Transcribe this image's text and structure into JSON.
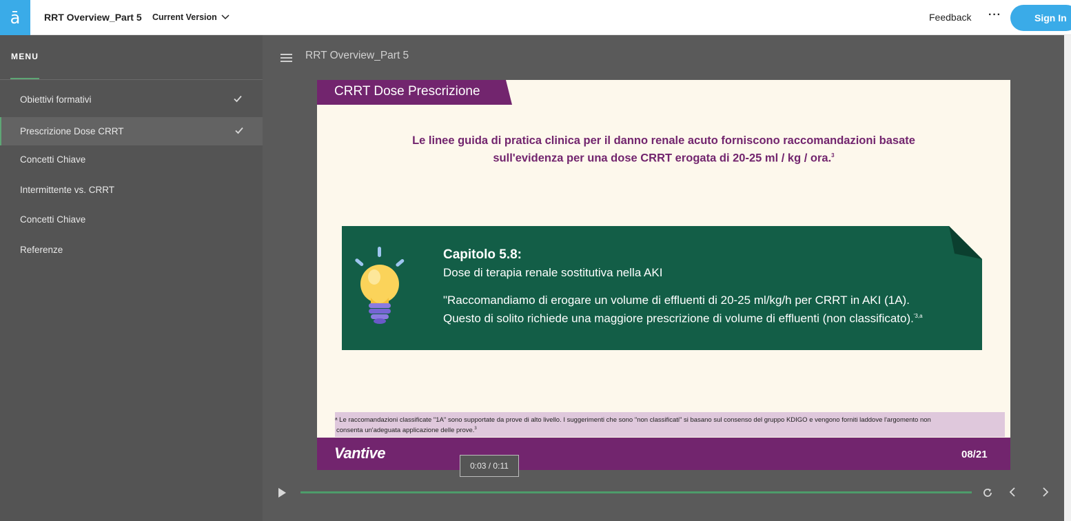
{
  "header": {
    "logo_glyph": "ā",
    "course_title": "RRT Overview_Part 5",
    "version_label": "Current Version",
    "feedback_label": "Feedback",
    "more_label": "···",
    "signin_label": "Sign In",
    "accent_color": "#3aabe8"
  },
  "sidebar": {
    "menu_title": "MENU",
    "items": [
      {
        "label": "Obiettivi formativi",
        "completed": true,
        "active": false
      },
      {
        "label": "Prescrizione Dose CRRT",
        "completed": true,
        "active": true
      },
      {
        "label": "Concetti Chiave",
        "completed": false,
        "active": false
      },
      {
        "label": "Intermittente vs. CRRT",
        "completed": false,
        "active": false
      },
      {
        "label": "Concetti Chiave",
        "completed": false,
        "active": false
      },
      {
        "label": "Referenze",
        "completed": false,
        "active": false
      }
    ]
  },
  "main": {
    "lesson_title": "RRT Overview_Part 5"
  },
  "slide": {
    "tab_title": "CRRT Dose Prescrizione",
    "headline_line1": "Le linee guida di pratica clinica per il danno renale acuto forniscono raccomandazioni basate",
    "headline_line2": "sull'evidenza per una dose CRRT erogata di 20-25 ml / kg / ora.",
    "headline_ref": "3",
    "chapter_title": "Capitolo 5.8:",
    "chapter_subtitle": "Dose di terapia renale sostitutiva nella AKI",
    "quote_line1": "\"Raccomandiamo di erogare un volume di effluenti di 20-25 ml/kg/h per CRRT in AKI (1A).",
    "quote_line2": "Questo di solito richiede una maggiore prescrizione di volume di effluenti (non classificato).",
    "quote_ref": "'3,a",
    "footnote_line1": "ᵃ Le raccomandazioni classificate \"1A\" sono supportate da prove di alto livello. I suggerimenti che sono \"non classificati\" si basano sul consenso del gruppo KDIGO e vengono forniti laddove l'argomento non",
    "footnote_line2": "consenta un'adeguata applicazione delle prove.",
    "footnote_ref": "3",
    "brand": "Vantive",
    "page_number": "08/21",
    "colors": {
      "purple": "#72256e",
      "green": "#135e47",
      "cream": "#fdf8ec"
    }
  },
  "player": {
    "time_tooltip": "0:03 / 0:11",
    "progress_fraction": 1.0
  }
}
